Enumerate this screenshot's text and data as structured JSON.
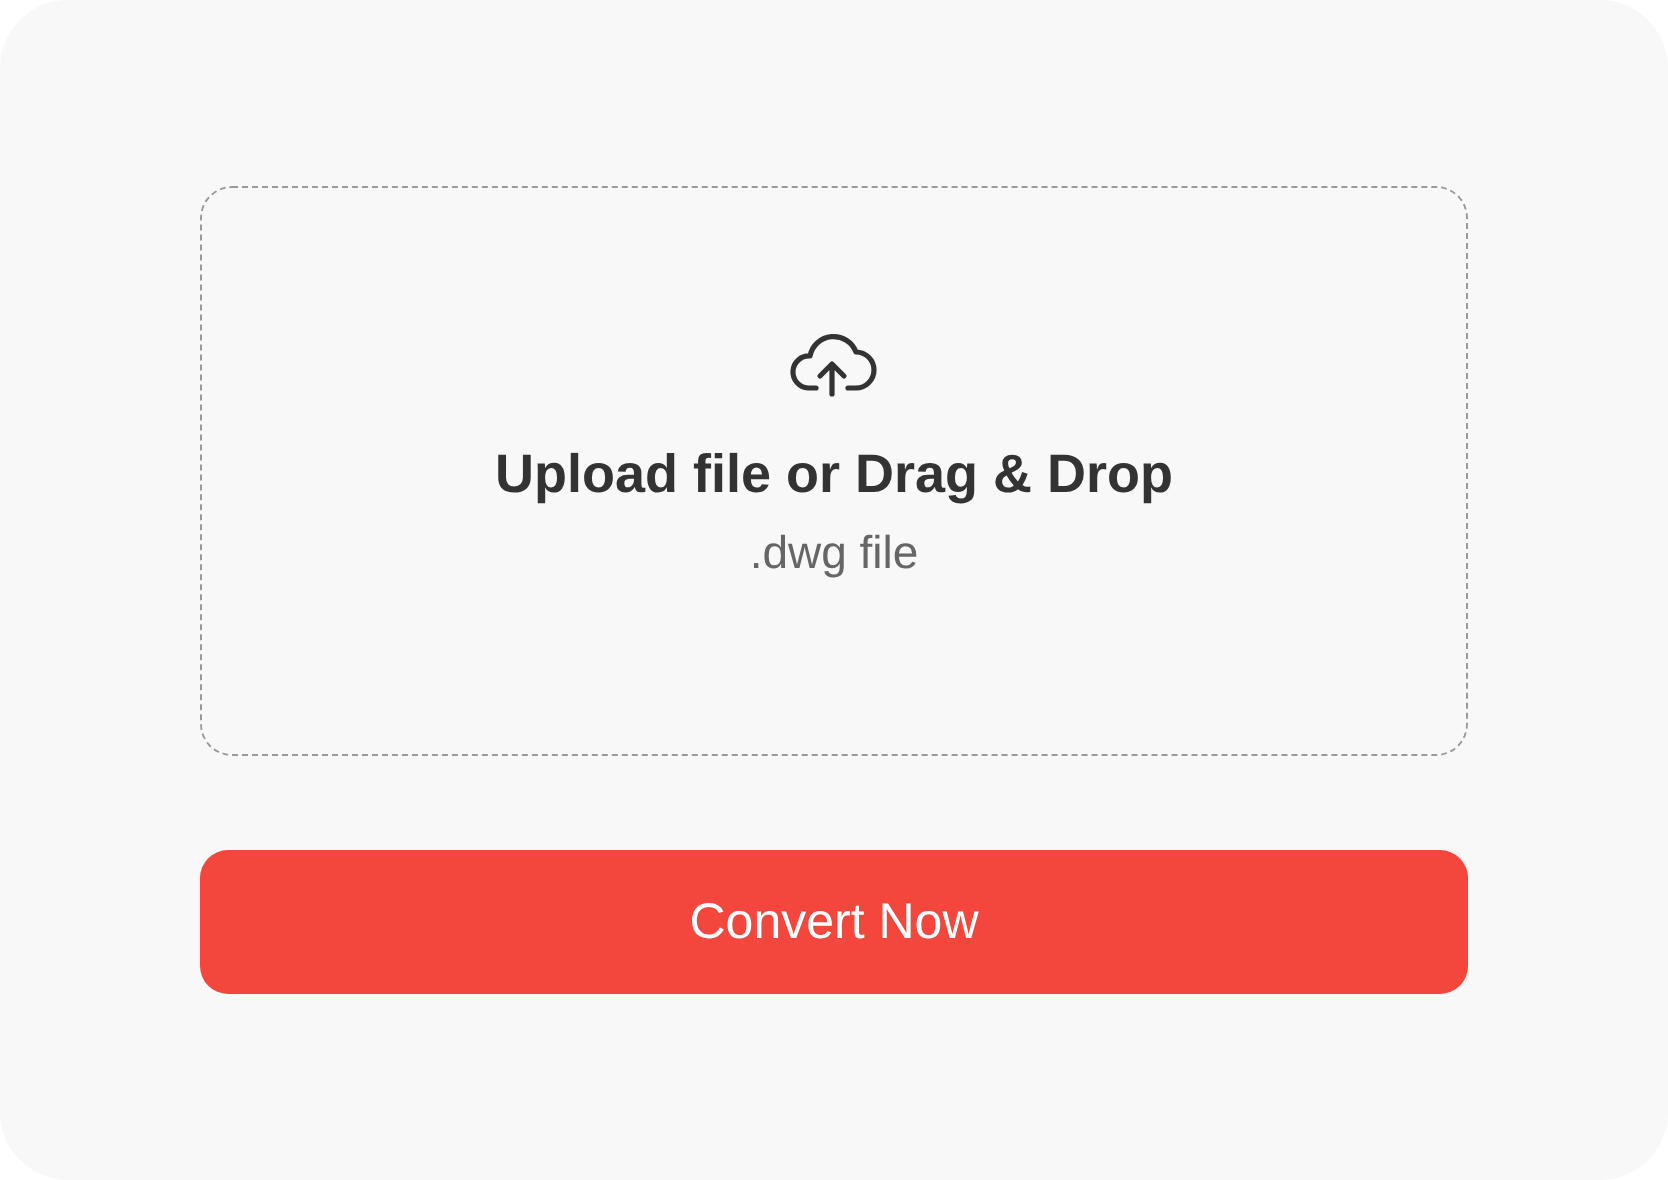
{
  "dropzone": {
    "title": "Upload file or Drag & Drop",
    "subtitle": ".dwg file"
  },
  "button": {
    "label": "Convert Now"
  }
}
